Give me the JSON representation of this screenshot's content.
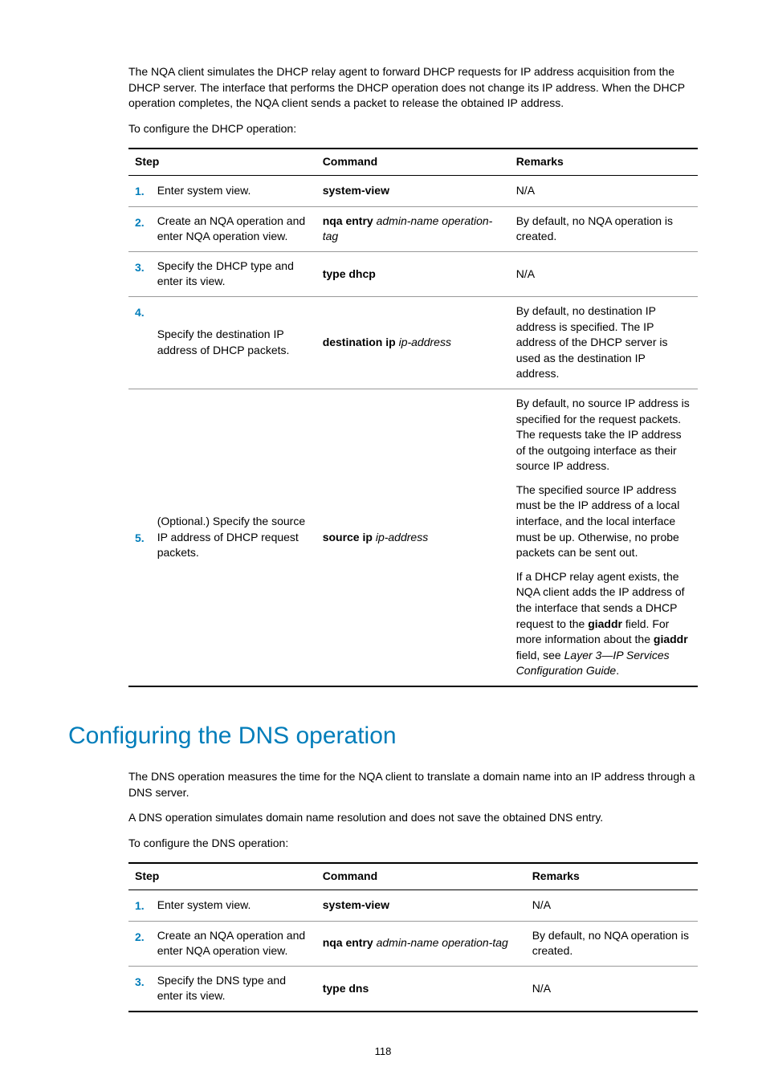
{
  "intro_dhcp": "The NQA client simulates the DHCP relay agent to forward DHCP requests for IP address acquisition from the DHCP server. The interface that performs the DHCP operation does not change its IP address. When the DHCP operation completes, the NQA client sends a packet to release the obtained IP address.",
  "config_prompt_dhcp": "To configure the DHCP operation:",
  "table_headers": {
    "step": "Step",
    "command": "Command",
    "remarks": "Remarks"
  },
  "dhcp_steps": [
    {
      "num": "1.",
      "action": "Enter system view.",
      "command_bold": "system-view",
      "remarks": "N/A"
    },
    {
      "num": "2.",
      "action": "Create an NQA operation and enter NQA operation view.",
      "command_bold": "nqa entry",
      "command_italic": " admin-name operation-tag",
      "remarks": "By default, no NQA operation is created."
    },
    {
      "num": "3.",
      "action": "Specify the DHCP type and enter its view.",
      "command_bold": "type dhcp",
      "remarks": "N/A"
    },
    {
      "num": "4.",
      "action": "Specify the destination IP address of DHCP packets.",
      "command_bold": "destination ip",
      "command_italic": " ip-address",
      "remarks": "By default, no destination IP address is specified. The IP address of the DHCP server is used as the destination IP address."
    },
    {
      "num": "5.",
      "action": "(Optional.) Specify the source IP address of DHCP request packets.",
      "command_bold": "source ip",
      "command_italic": " ip-address",
      "remarks_multi": {
        "p1": "By default, no source IP address is specified for the request packets. The requests take the IP address of the outgoing interface as their source IP address.",
        "p2": "The specified source IP address must be the IP address of a local interface, and the local interface must be up. Otherwise, no probe packets can be sent out.",
        "p3_pre": "If a DHCP relay agent exists, the NQA client adds the IP address of the interface that sends a DHCP request to the ",
        "p3_bold1": "giaddr",
        "p3_mid": " field. For more information about the ",
        "p3_bold2": "giaddr",
        "p3_post": " field, see ",
        "p3_italic": "Layer 3—IP Services Configuration Guide",
        "p3_end": "."
      }
    }
  ],
  "heading_dns": "Configuring the DNS operation",
  "intro_dns_1": "The DNS operation measures the time for the NQA client to translate a domain name into an IP address through a DNS server.",
  "intro_dns_2": "A DNS operation simulates domain name resolution and does not save the obtained DNS entry.",
  "config_prompt_dns": "To configure the DNS operation:",
  "dns_steps": [
    {
      "num": "1.",
      "action": "Enter system view.",
      "command_bold": "system-view",
      "remarks": "N/A"
    },
    {
      "num": "2.",
      "action": "Create an NQA operation and enter NQA operation view.",
      "command_bold": "nqa entry",
      "command_italic": " admin-name operation-tag",
      "remarks": "By default, no NQA operation is created."
    },
    {
      "num": "3.",
      "action": "Specify the DNS type and enter its view.",
      "command_bold": "type dns",
      "remarks": "N/A"
    }
  ],
  "page_number": "118"
}
